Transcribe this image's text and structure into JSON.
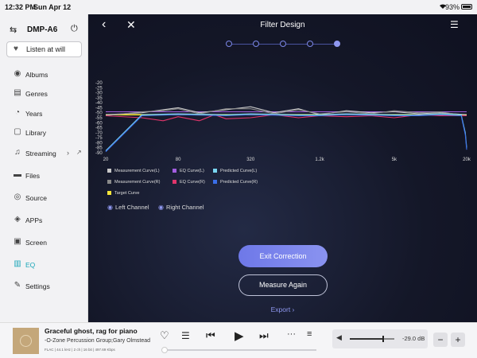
{
  "status": {
    "time": "12:32 PM",
    "date": "Sun Apr 12",
    "battery": "93%"
  },
  "sidebar": {
    "device": "DMP-A6",
    "listen": "Listen at will",
    "items": [
      {
        "label": "Albums",
        "icon": "album-icon"
      },
      {
        "label": "Genres",
        "icon": "genres-icon"
      },
      {
        "label": "Years",
        "icon": "years-icon"
      },
      {
        "label": "Library",
        "icon": "library-icon"
      },
      {
        "label": "Streaming",
        "icon": "streaming-icon"
      },
      {
        "label": "Files",
        "icon": "folder-icon"
      },
      {
        "label": "Source",
        "icon": "source-icon"
      },
      {
        "label": "APPs",
        "icon": "apps-icon"
      },
      {
        "label": "Screen",
        "icon": "screen-icon"
      },
      {
        "label": "EQ",
        "icon": "eq-icon"
      },
      {
        "label": "Settings",
        "icon": "settings-icon"
      }
    ],
    "active": "EQ",
    "accent": "#1aa6b8"
  },
  "main": {
    "title": "Filter Design",
    "steps_total": 5,
    "step_current": 5,
    "exit_button": "Exit Correction",
    "measure_button": "Measure Again",
    "export_link": "Export ›",
    "left_channel": "Left Channel",
    "right_channel": "Right Channel",
    "accent": "#7b86e6"
  },
  "chart_data": {
    "type": "line",
    "xscale": "log",
    "x_ticks": [
      "20",
      "80",
      "320",
      "1.2k",
      "5k",
      "20k"
    ],
    "y_ticks": [
      "-20",
      "-25",
      "-30",
      "-35",
      "-40",
      "-45",
      "-50",
      "-55",
      "-60",
      "-65",
      "-70",
      "-75",
      "-80",
      "-85",
      "-90"
    ],
    "ylim": [
      -90,
      -20
    ],
    "legend": [
      {
        "name": "Measurement Curve(L)",
        "color": "#c8c8c8"
      },
      {
        "name": "EQ Curve(L)",
        "color": "#a35de0"
      },
      {
        "name": "Predicted Curve(L)",
        "color": "#7ad6f0"
      },
      {
        "name": "Measurement Curve(R)",
        "color": "#8a8a8a"
      },
      {
        "name": "EQ Curve(R)",
        "color": "#e0356b"
      },
      {
        "name": "Predicted Curve(R)",
        "color": "#3a6ee8"
      },
      {
        "name": "Target Curve",
        "color": "#f5e53a"
      }
    ],
    "series": [
      {
        "name": "Target Curve",
        "color": "#f5e53a",
        "x": [
          20,
          20000
        ],
        "y": [
          -52,
          -52
        ]
      },
      {
        "name": "EQ Curve(L)",
        "color": "#a35de0",
        "x": [
          20,
          20000
        ],
        "y": [
          -49,
          -49
        ]
      },
      {
        "name": "Measurement Curve(L)",
        "color": "#c8c8c8",
        "x": [
          20,
          40,
          60,
          80,
          120,
          200,
          320,
          500,
          800,
          1200,
          2000,
          3200,
          5000,
          8000,
          12000,
          20000
        ],
        "y": [
          -52,
          -50,
          -47,
          -45,
          -50,
          -47,
          -44,
          -50,
          -46,
          -52,
          -48,
          -50,
          -49,
          -51,
          -50,
          -52
        ]
      },
      {
        "name": "Measurement Curve(R)",
        "color": "#8a8a8a",
        "x": [
          20,
          40,
          60,
          80,
          120,
          200,
          320,
          500,
          800,
          1200,
          2000,
          3200,
          5000,
          8000,
          12000,
          20000
        ],
        "y": [
          -53,
          -49,
          -48,
          -46,
          -51,
          -46,
          -46,
          -51,
          -47,
          -51,
          -49,
          -51,
          -48,
          -50,
          -49,
          -53
        ]
      },
      {
        "name": "EQ Curve(R)",
        "color": "#e0356b",
        "x": [
          20,
          40,
          60,
          80,
          120,
          160,
          200,
          320,
          500,
          800,
          1200,
          2000,
          3200,
          5000,
          8000,
          12000,
          20000
        ],
        "y": [
          -53,
          -55,
          -58,
          -54,
          -58,
          -52,
          -56,
          -55,
          -52,
          -55,
          -53,
          -54,
          -53,
          -55,
          -52,
          -53,
          -53
        ]
      },
      {
        "name": "Predicted Curve(L)",
        "color": "#7ad6f0",
        "x": [
          20,
          40,
          80,
          200,
          320,
          800,
          1200,
          2000,
          5000,
          8000,
          12000,
          18000,
          19500,
          20000
        ],
        "y": [
          -88,
          -52,
          -51,
          -52,
          -51,
          -52,
          -52,
          -51,
          -52,
          -52,
          -51,
          -52,
          -70,
          -85
        ]
      },
      {
        "name": "Predicted Curve(R)",
        "color": "#3a6ee8",
        "x": [
          20,
          40,
          80,
          200,
          320,
          800,
          1200,
          2000,
          5000,
          8000,
          12000,
          18000,
          19500,
          20000
        ],
        "y": [
          -89,
          -53,
          -52,
          -53,
          -52,
          -53,
          -53,
          -52,
          -53,
          -53,
          -52,
          -53,
          -72,
          -87
        ]
      }
    ]
  },
  "player": {
    "track": "Graceful ghost, rag for piano",
    "artist": "-O-Zone Percussion Group;Gary Olmstead",
    "format": "FLAC | 44.1 kHz | 2 ch | 16 bit | 497.69 Kbps",
    "progress": 0.0,
    "volume_db": "-29.0 dB",
    "volume_level": 0.75
  }
}
